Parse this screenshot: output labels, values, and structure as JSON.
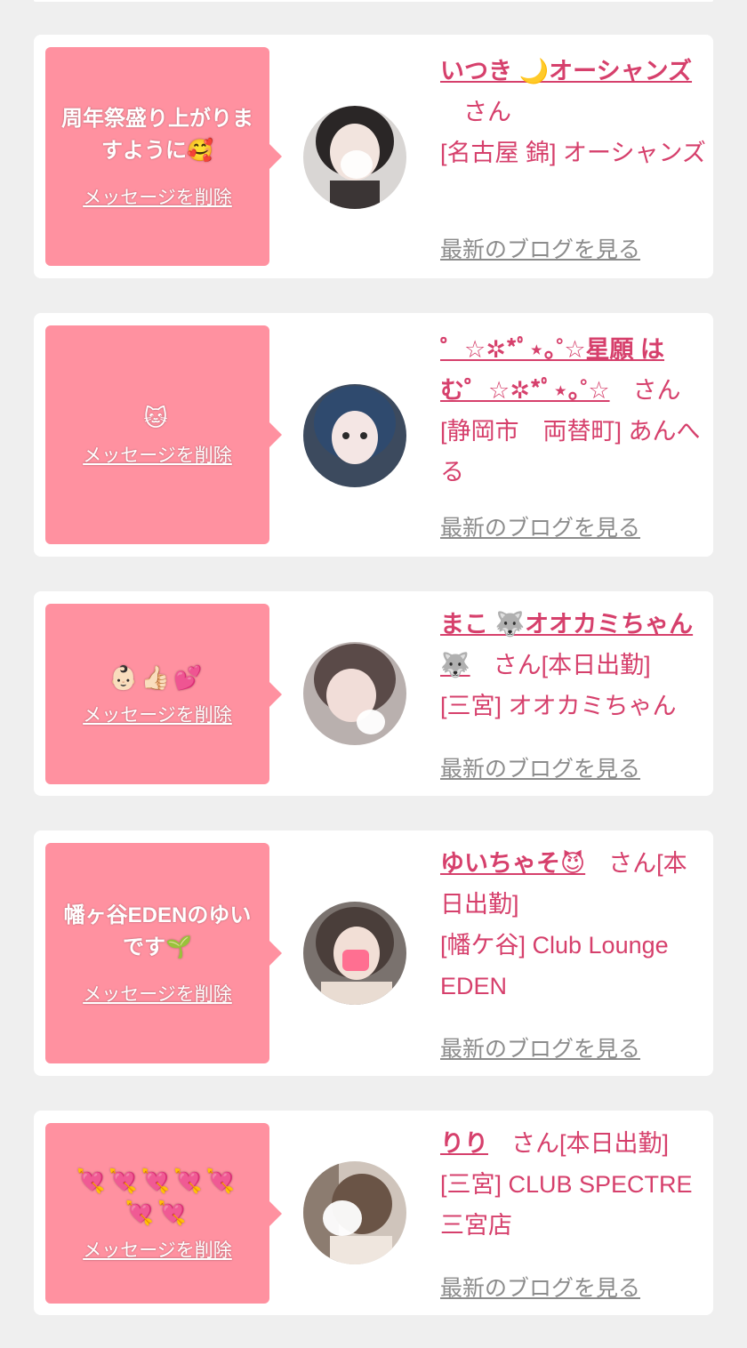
{
  "delete_label": "メッセージを削除",
  "blog_label": "最新のブログを見る",
  "colors": {
    "background": "#efefef",
    "card": "#ffffff",
    "bubble": "#ff91a0",
    "accent": "#d6406c",
    "muted": "#8c8c8c"
  },
  "cards": [
    {
      "message": "周年祭盛り上がりますように🥰",
      "name": "いつき 🌙オーシャンズ",
      "san": "さん",
      "area": "[名古屋 錦] オーシャンズ"
    },
    {
      "message": "🐱",
      "name": "゜☆✲*ﾟ⋆｡˚☆星願 はむ゜☆✲*ﾟ⋆｡˚☆",
      "san": "さん",
      "area": "[静岡市　両替町] あんへる"
    },
    {
      "message": "👶🏻👍🏻💕",
      "name": "まこ 🐺オオカミちゃん🐺",
      "san": "さん[本日出勤]",
      "area": "[三宮] オオカミちゃん"
    },
    {
      "message": "幡ヶ谷EDENのゆいです🌱",
      "name": "ゆいちゃそ😈",
      "san": "さん[本日出勤]",
      "area": "[幡ケ谷] Club Lounge EDEN"
    },
    {
      "message": "💘💘💘💘💘💘💘",
      "name": "りり",
      "san": "さん[本日出勤]",
      "area": "[三宮] CLUB SPECTRE 三宮店"
    }
  ]
}
